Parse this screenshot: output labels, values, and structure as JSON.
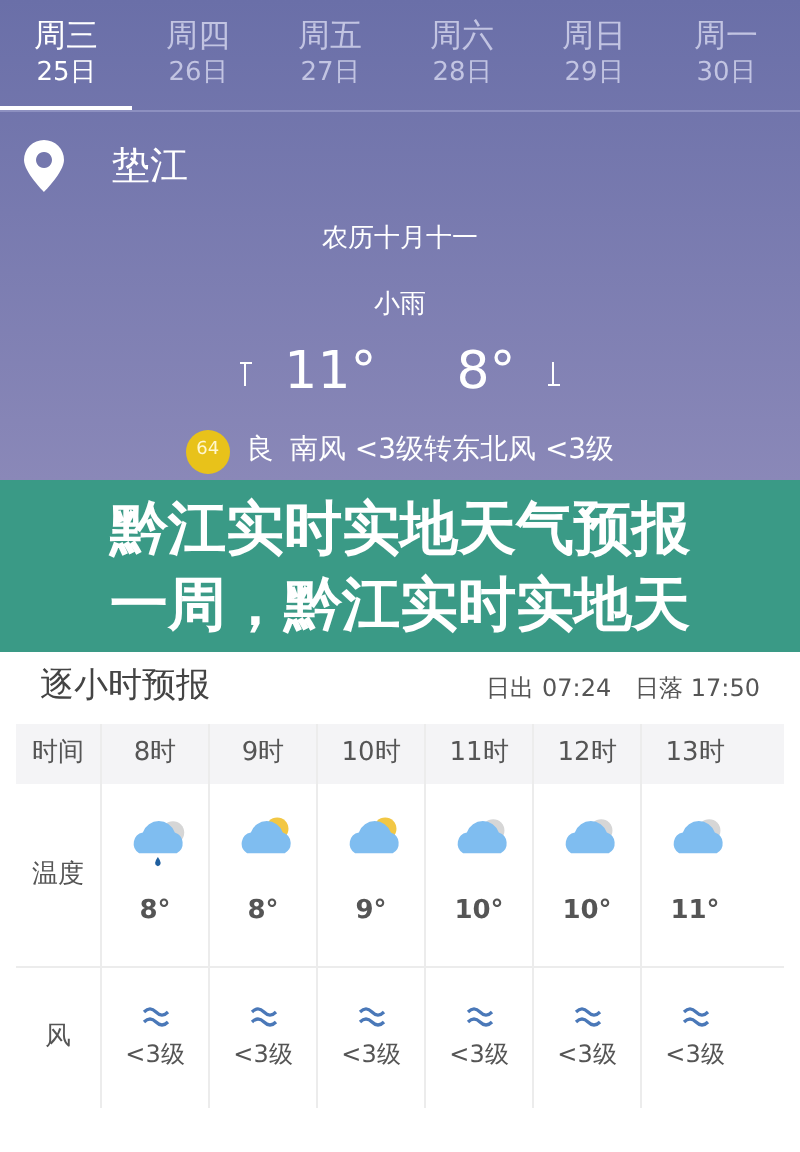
{
  "days": [
    {
      "weekday": "周三",
      "date": "25日",
      "selected": true
    },
    {
      "weekday": "周四",
      "date": "26日",
      "selected": false
    },
    {
      "weekday": "周五",
      "date": "27日",
      "selected": false
    },
    {
      "weekday": "周六",
      "date": "28日",
      "selected": false
    },
    {
      "weekday": "周日",
      "date": "29日",
      "selected": false
    },
    {
      "weekday": "周一",
      "date": "30日",
      "selected": false
    }
  ],
  "location": "垫江",
  "lunar_date": "农历十月十一",
  "condition": "小雨",
  "high": "11°",
  "low": "8°",
  "air": {
    "aqi": "64",
    "quality": "良"
  },
  "wind": "南风 <3级转东北风 <3级",
  "headline": [
    "黔江实时实地天气预报",
    "一周，黔江实时实地天"
  ],
  "hourly": {
    "title": "逐小时预报",
    "sunrise": "日出 07:24",
    "sunset": "日落 17:50",
    "row_labels": [
      "时间",
      "温度",
      "风"
    ],
    "hours": [
      {
        "time": "8时",
        "kind": "rain",
        "temp": "8°",
        "wind": "<3级"
      },
      {
        "time": "9时",
        "kind": "sun-cloud",
        "temp": "8°",
        "wind": "<3级"
      },
      {
        "time": "10时",
        "kind": "sun-cloud",
        "temp": "9°",
        "wind": "<3级"
      },
      {
        "time": "11时",
        "kind": "cloudy",
        "temp": "10°",
        "wind": "<3级"
      },
      {
        "time": "12时",
        "kind": "cloudy",
        "temp": "10°",
        "wind": "<3级"
      },
      {
        "time": "13时",
        "kind": "cloudy",
        "temp": "11°",
        "wind": "<3级"
      }
    ]
  }
}
